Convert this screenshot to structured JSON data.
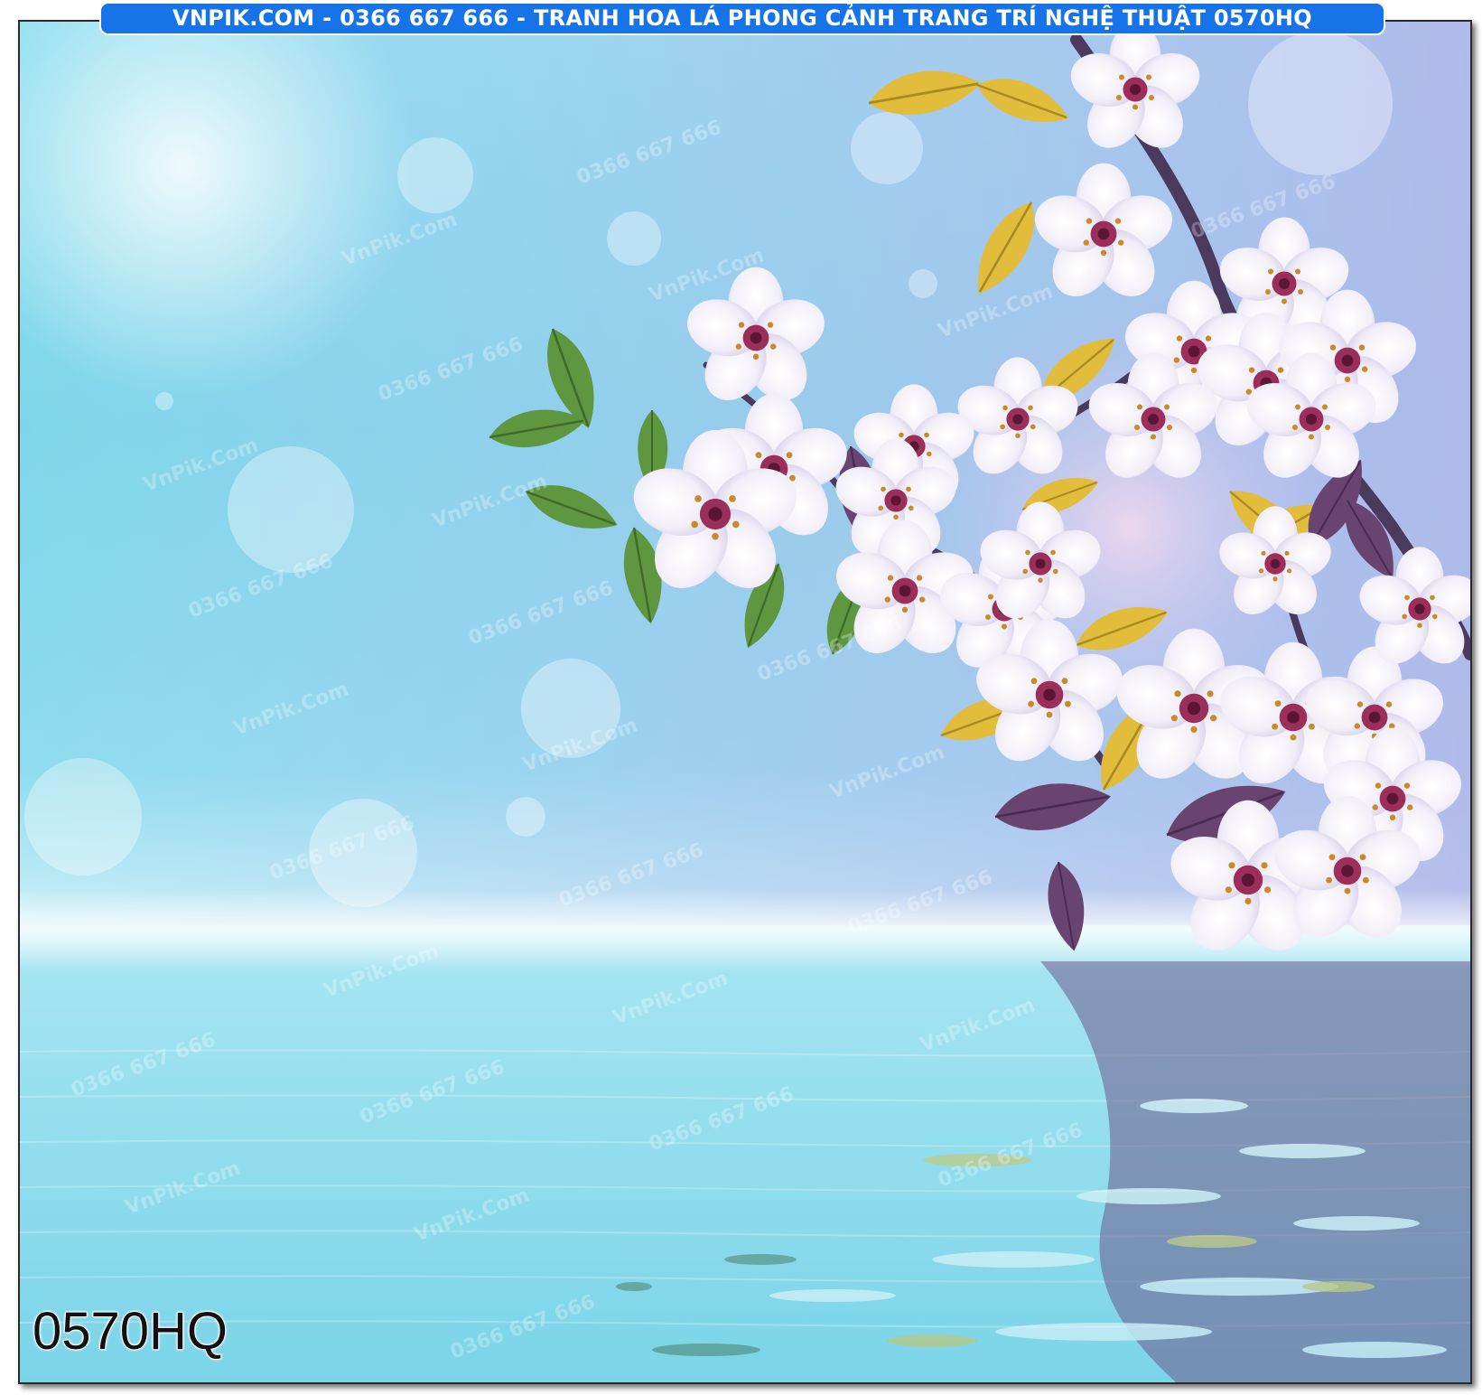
{
  "banner": {
    "text": "VNPIK.COM - 0366 667 666 - TRANH HOA LÁ PHONG CẢNH TRANG TRÍ NGHỆ THUẬT 0570HQ",
    "background_color": "#1773e8"
  },
  "code_label": {
    "text": "0570HQ"
  },
  "watermark": {
    "brand": "VnPik.Com",
    "phone": "0366 667 666"
  },
  "scene": {
    "subject": "white cherry blossom branch reflected in water",
    "sky_color": "#8fdff0",
    "water_color": "#7ad4e8",
    "petal_color": "#f6f2fb",
    "leaf_colors": [
      "#e6c23a",
      "#5f8f3e",
      "#6b3f6a"
    ]
  }
}
